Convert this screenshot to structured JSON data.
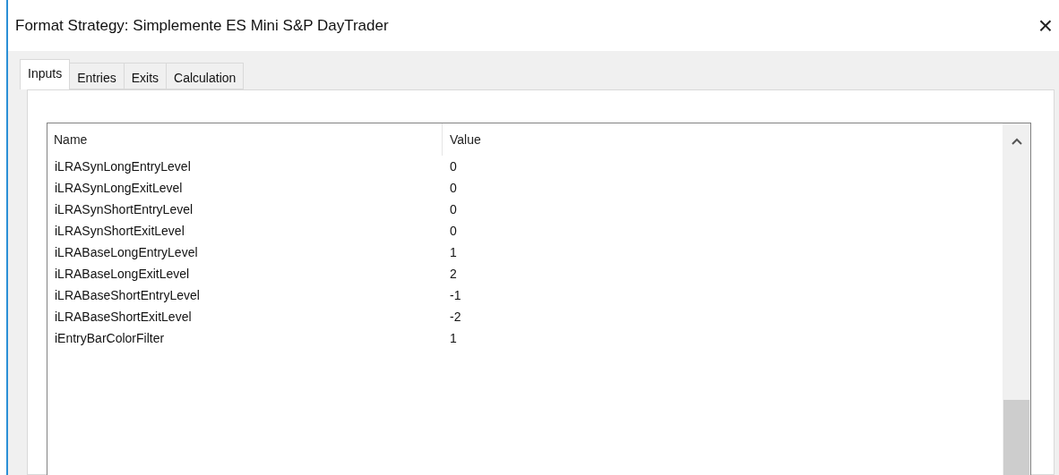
{
  "window": {
    "title": "Format Strategy: Simplemente ES Mini S&P DayTrader",
    "close": "×"
  },
  "tabs": [
    {
      "label": "Inputs",
      "selected": true
    },
    {
      "label": "Entries",
      "selected": false
    },
    {
      "label": "Exits",
      "selected": false
    },
    {
      "label": "Calculation",
      "selected": false
    }
  ],
  "table": {
    "columns": [
      "Name",
      "Value"
    ],
    "rows": [
      {
        "name": "iLRASynLongEntryLevel",
        "value": "0"
      },
      {
        "name": "iLRASynLongExitLevel",
        "value": "0"
      },
      {
        "name": "iLRASynShortEntryLevel",
        "value": "0"
      },
      {
        "name": "iLRASynShortExitLevel",
        "value": "0"
      },
      {
        "name": "iLRABaseLongEntryLevel",
        "value": "1"
      },
      {
        "name": "iLRABaseLongExitLevel",
        "value": "2"
      },
      {
        "name": "iLRABaseShortEntryLevel",
        "value": "-1"
      },
      {
        "name": "iLRABaseShortExitLevel",
        "value": "-2"
      },
      {
        "name": "iEntryBarColorFilter",
        "value": "1"
      }
    ]
  }
}
